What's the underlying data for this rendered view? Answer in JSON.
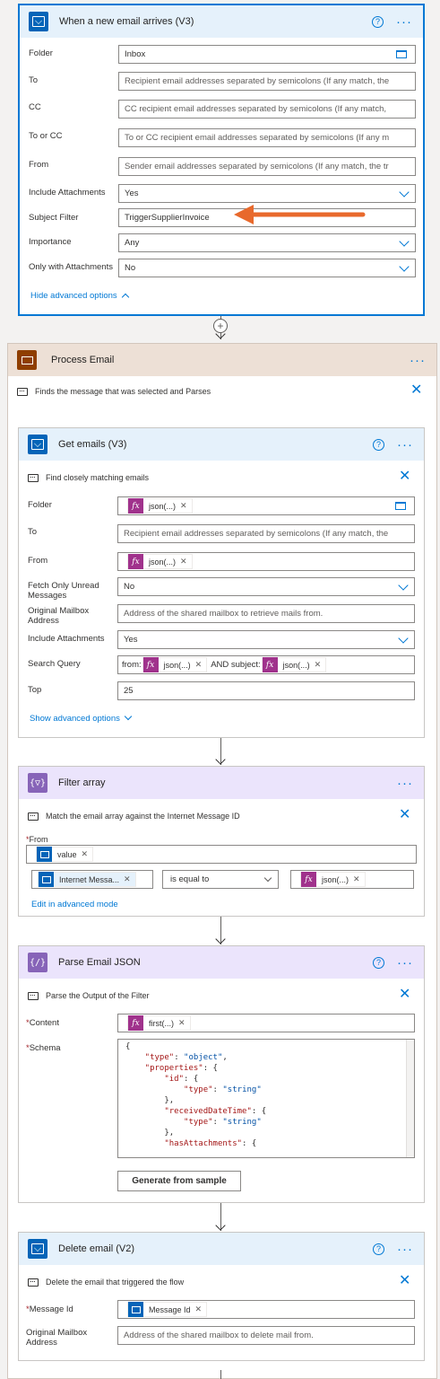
{
  "trigger": {
    "title": "When a new email arrives (V3)",
    "fields": [
      {
        "label": "Folder",
        "value": "Inbox",
        "kind": "folder"
      },
      {
        "label": "To",
        "placeholder": "Recipient email addresses separated by semicolons (If any match, the"
      },
      {
        "label": "CC",
        "placeholder": "CC recipient email addresses separated by semicolons (If any match,"
      },
      {
        "label": "To or CC",
        "placeholder": "To or CC recipient email addresses separated by semicolons (If any m"
      },
      {
        "label": "From",
        "placeholder": "Sender email addresses separated by semicolons (If any match, the tr"
      },
      {
        "label": "Include Attachments",
        "value": "Yes",
        "kind": "dropdown"
      },
      {
        "label": "Subject Filter",
        "value": "TriggerSupplierInvoice"
      },
      {
        "label": "Importance",
        "value": "Any",
        "kind": "dropdown"
      },
      {
        "label": "Only with Attachments",
        "value": "No",
        "kind": "dropdown"
      }
    ],
    "advanced_link": "Hide advanced options"
  },
  "scope": {
    "title": "Process Email",
    "comment": "Finds the message that was selected and Parses"
  },
  "get_emails": {
    "title": "Get emails (V3)",
    "comment": "Find closely matching emails",
    "folder_label": "Folder",
    "folder_token": "json(...)",
    "to_label": "To",
    "to_placeholder": "Recipient email addresses separated by semicolons (If any match, the",
    "from_label": "From",
    "from_token": "json(...)",
    "unread_label": "Fetch Only Unread Messages",
    "unread_value": "No",
    "mailbox_label": "Original Mailbox Address",
    "mailbox_placeholder": "Address of the shared mailbox to retrieve mails from.",
    "attach_label": "Include Attachments",
    "attach_value": "Yes",
    "search_label": "Search Query",
    "search_prefix": "from:",
    "search_token1": "json(...)",
    "search_mid": "AND subject:",
    "search_token2": "json(...)",
    "top_label": "Top",
    "top_value": "25",
    "advanced_link": "Show advanced options"
  },
  "filter": {
    "title": "Filter array",
    "comment": "Match the email array against the Internet Message ID",
    "from_label": "From",
    "from_token": "value",
    "left_token": "Internet Messa...",
    "operator": "is equal to",
    "right_token": "json(...)",
    "advanced_link": "Edit in advanced mode"
  },
  "parse": {
    "title": "Parse Email JSON",
    "comment": "Parse the Output of the Filter",
    "content_label": "Content",
    "content_token": "first(...)",
    "schema_label": "Schema",
    "button": "Generate from sample"
  },
  "delete": {
    "title": "Delete email (V2)",
    "comment": "Delete the email that triggered the flow",
    "msgid_label": "Message Id",
    "msgid_token": "Message Id",
    "mailbox_label": "Original Mailbox Address",
    "mailbox_placeholder": "Address of the shared mailbox to delete mail from."
  },
  "colors": {
    "accent": "#0078d4",
    "arrow": "#e8692c",
    "expression": "#a0328c",
    "outlook": "#0364b8"
  }
}
